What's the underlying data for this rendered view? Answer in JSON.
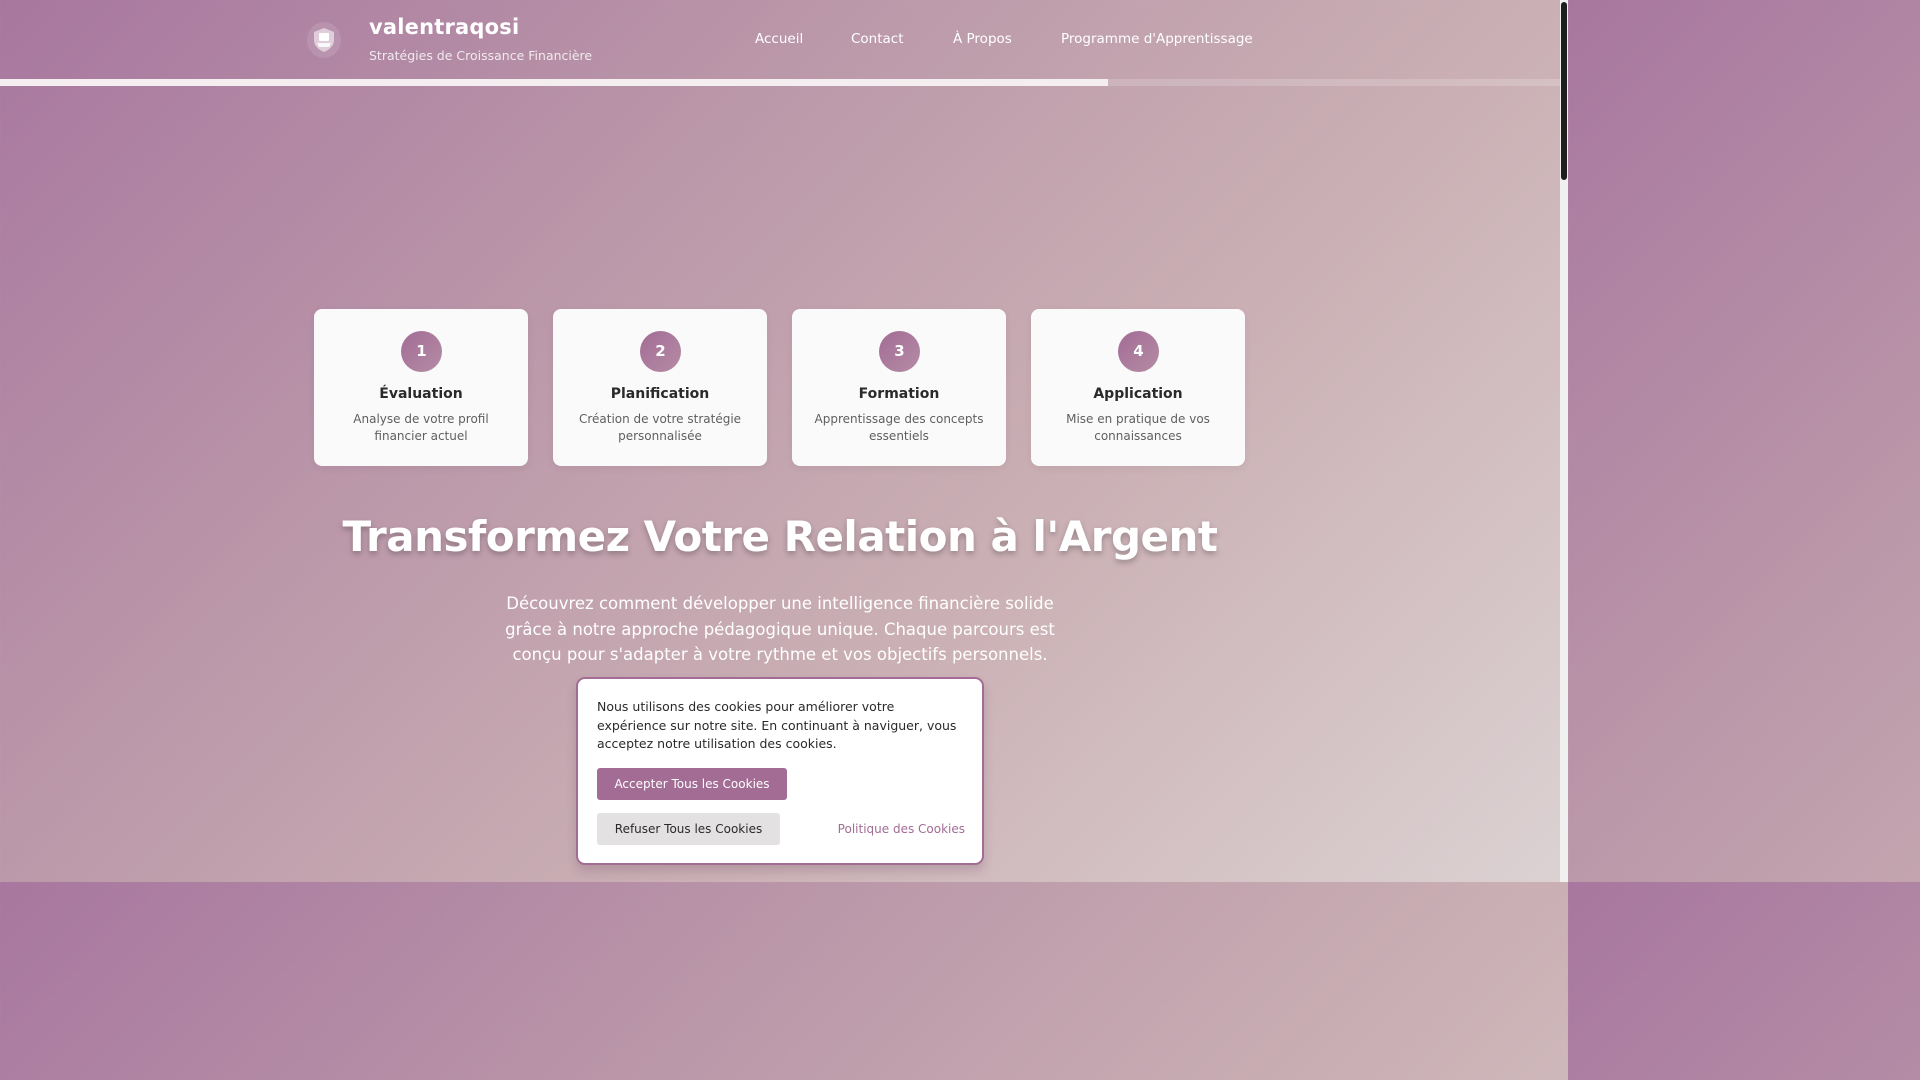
{
  "header": {
    "brand_name": "valentraqosi",
    "tagline": "Stratégies de Croissance Financière",
    "logo_icon": "shield-logo-icon",
    "nav": {
      "home": "Accueil",
      "contact": "Contact",
      "about": "À Propos",
      "program": "Programme d'Apprentissage"
    }
  },
  "scroll_progress": 0.71,
  "steps": [
    {
      "number": "1",
      "title": "Évaluation",
      "description": "Analyse de votre profil financier actuel"
    },
    {
      "number": "2",
      "title": "Planification",
      "description": "Création de votre stratégie personnalisée"
    },
    {
      "number": "3",
      "title": "Formation",
      "description": "Apprentissage des concepts essentiels"
    },
    {
      "number": "4",
      "title": "Application",
      "description": "Mise en pratique de vos connaissances"
    }
  ],
  "hero": {
    "title": "Transformez Votre Relation à l'Argent",
    "description": "Découvrez comment développer une intelligence financière solide grâce à notre approche pédagogique unique. Chaque parcours est conçu pour s'adapter à votre rythme et vos objectifs personnels."
  },
  "cookie_banner": {
    "text": "Nous utilisons des cookies pour améliorer votre expérience sur notre site. En continuant à naviguer, vous acceptez notre utilisation des cookies.",
    "accept_label": "Accepter Tous les Cookies",
    "refuse_label": "Refuser Tous les Cookies",
    "policy_link": "Politique des Cookies"
  },
  "colors": {
    "accent": "#a26c95",
    "card_background": "#fbfafa",
    "refuse_button": "#e4e1e2"
  }
}
